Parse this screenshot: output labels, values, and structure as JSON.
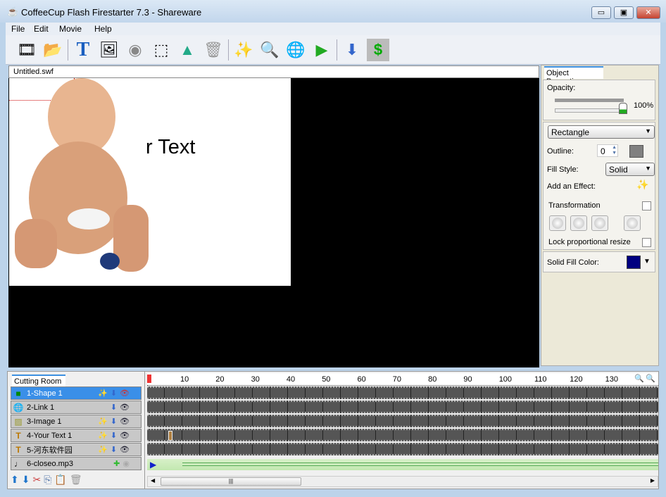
{
  "window": {
    "title": "CoffeeCup Flash Firestarter 7.3 - Shareware",
    "min": "▭",
    "max": "▣",
    "close": "✕"
  },
  "menu": [
    "File",
    "Edit",
    "Movie",
    "Help"
  ],
  "toolbar": [
    "film-icon",
    "open-folder-icon",
    "text-icon",
    "image-icon",
    "sound-icon",
    "select-icon",
    "shapes-icon",
    "trash-icon",
    "effects-wand-icon",
    "preview-icon",
    "publish-web-icon",
    "play-movie-icon",
    "export-icon",
    "buy-icon"
  ],
  "document": {
    "tab": "Untitled.swf",
    "stage_text": "r Text"
  },
  "properties": {
    "tab": "Object Properties",
    "opacity_label": "Opacity:",
    "opacity_value": "100%",
    "opacity": 1.0,
    "shape": "Rectangle",
    "outline_label": "Outline:",
    "outline_value": "0",
    "fill_style_label": "Fill Style:",
    "fill_style": "Solid",
    "effect_label": "Add an Effect:",
    "transformation_label": "Transformation",
    "lock_label": "Lock proportional resize",
    "fill_color_label": "Solid Fill Color:",
    "fill_color": "#000080",
    "outline_color": "#808080"
  },
  "cutting_room": {
    "tab": "Cutting Room",
    "layers": [
      {
        "name": "1-Shape 1",
        "icon": "■",
        "selected": true
      },
      {
        "name": "2-Link 1",
        "icon": "🌐"
      },
      {
        "name": "3-Image 1",
        "icon": "▨"
      },
      {
        "name": "4-Your Text 1",
        "icon": "T"
      },
      {
        "name": "5-河东软件园",
        "icon": "T"
      },
      {
        "name": "6-closeo.mp3",
        "icon": "♩"
      }
    ]
  },
  "timeline": {
    "ticks": [
      "10",
      "20",
      "30",
      "40",
      "50",
      "60",
      "70",
      "80",
      "90",
      "100",
      "110",
      "120",
      "130"
    ]
  },
  "scroll_grip": "|||"
}
